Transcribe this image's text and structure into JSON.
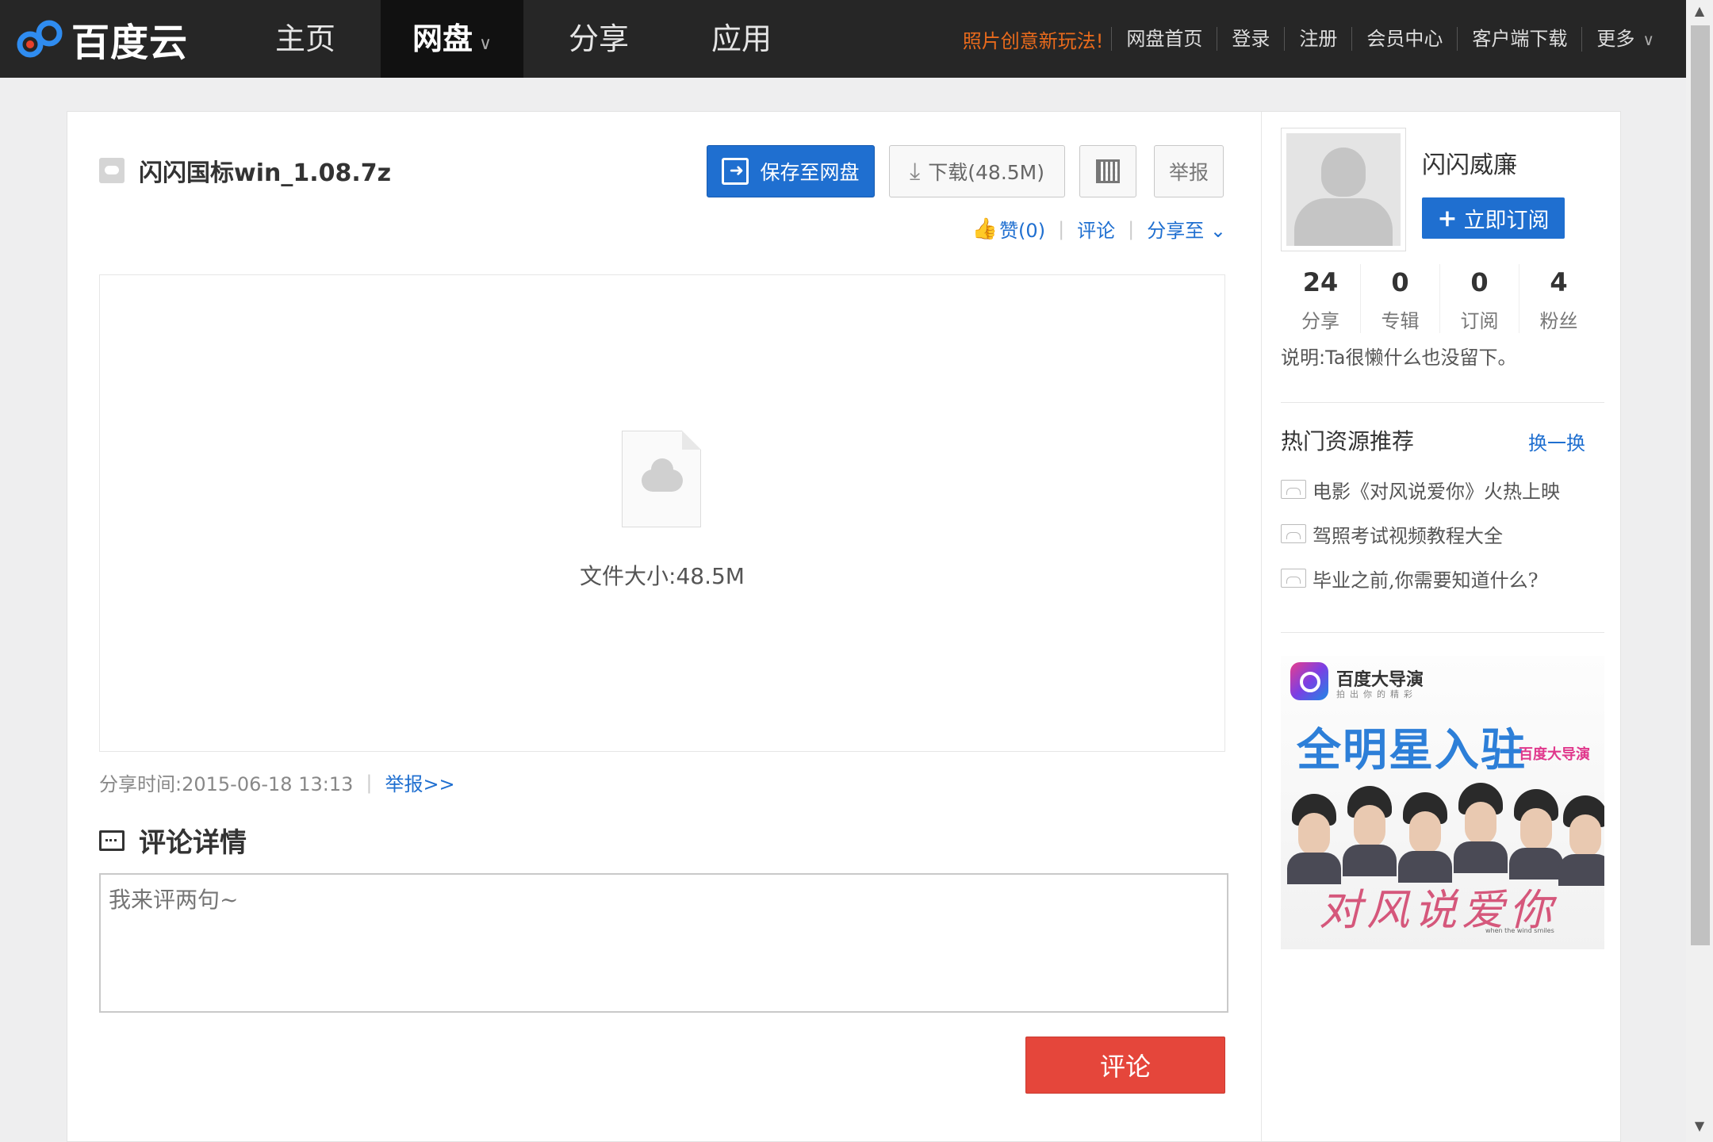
{
  "header": {
    "logo_text": "百度云",
    "nav": {
      "home": "主页",
      "pan": "网盘",
      "share": "分享",
      "app": "应用"
    },
    "promo": "照片创意新玩法!",
    "links": [
      "网盘首页",
      "登录",
      "注册",
      "会员中心",
      "客户端下载"
    ],
    "more": "更多",
    "colors": {
      "bar": "#262626",
      "promo": "#e86a1c"
    }
  },
  "file": {
    "name": "闪闪国标win_1.08.7z",
    "save_label": "保存至网盘",
    "download_label": "下载(48.5M)",
    "report_label": "举报",
    "like_label": "赞(0)",
    "comment_link": "评论",
    "share_to": "分享至",
    "size_text": "文件大小:48.5M",
    "share_time": "分享时间:2015-06-18 13:13",
    "report_link": "举报>>"
  },
  "comments": {
    "title": "评论详情",
    "placeholder": "我来评两句~",
    "submit_label": "评论"
  },
  "user": {
    "name": "闪闪威廉",
    "subscribe_label": "立即订阅",
    "stats": [
      {
        "num": "24",
        "label": "分享"
      },
      {
        "num": "0",
        "label": "专辑"
      },
      {
        "num": "0",
        "label": "订阅"
      },
      {
        "num": "4",
        "label": "粉丝"
      }
    ],
    "desc": "说明:Ta很懒什么也没留下。"
  },
  "hot": {
    "title": "热门资源推荐",
    "refresh": "换一换",
    "items": [
      "电影《对风说爱你》火热上映",
      "驾照考试视频教程大全",
      "毕业之前,你需要知道什么?"
    ]
  },
  "ad": {
    "brand": "百度大导演",
    "slogan": "拍出你的精彩",
    "headline": "全明星入驻",
    "sub": "百度大导演",
    "script": "对风说爱你",
    "mini": "when the wind smiles"
  },
  "accent": "#1f6fd0",
  "danger": "#e5463b"
}
